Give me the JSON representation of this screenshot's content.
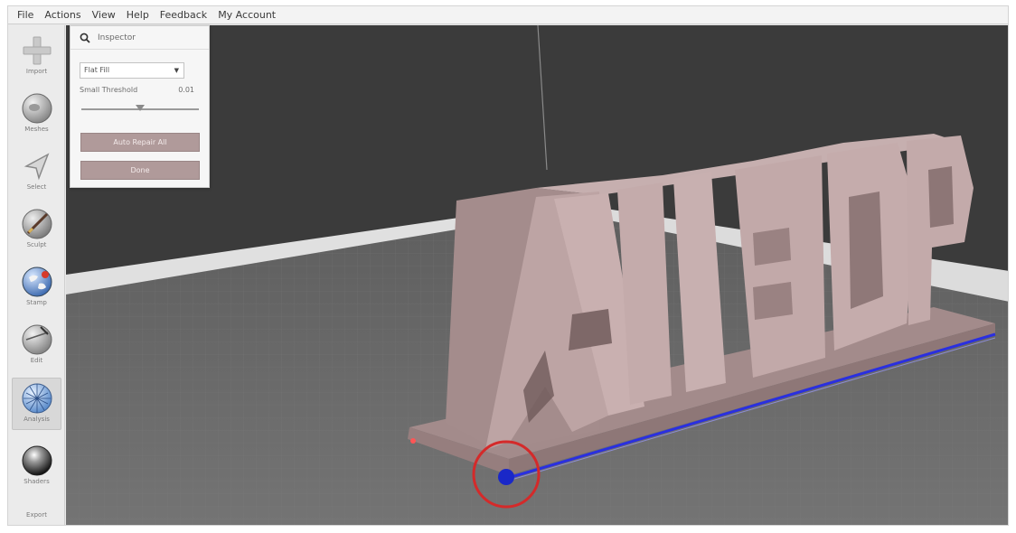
{
  "menu": {
    "items": [
      "File",
      "Actions",
      "View",
      "Help",
      "Feedback",
      "My Account"
    ]
  },
  "toolbar": {
    "tools": [
      {
        "label": "Import",
        "icon": "plus-icon"
      },
      {
        "label": "Meshes",
        "icon": "sphere-icon"
      },
      {
        "label": "Select",
        "icon": "arrow-cursor-icon"
      },
      {
        "label": "Sculpt",
        "icon": "brush-icon"
      },
      {
        "label": "Stamp",
        "icon": "globe-stamp-icon"
      },
      {
        "label": "Edit",
        "icon": "edit-sphere-icon"
      },
      {
        "label": "Analysis",
        "icon": "wire-sphere-icon"
      },
      {
        "label": "Shaders",
        "icon": "shiny-sphere-icon"
      },
      {
        "label": "Export",
        "icon": "export-icon"
      }
    ]
  },
  "inspector": {
    "title": "Inspector",
    "select_value": "Flat Fill",
    "threshold_label": "Small Threshold",
    "threshold_value": "0.01",
    "slider_fraction": 0.5,
    "auto_button": "Auto Repair All",
    "done_button": "Done"
  },
  "model": {
    "text": "All3DP"
  },
  "colors": {
    "model_fill": "#b39a9a",
    "highlight_edge": "#2233dd",
    "marker_circle": "#d42a2a",
    "background_wall": "#3a3a3a",
    "floor": "#6b6b6b"
  }
}
